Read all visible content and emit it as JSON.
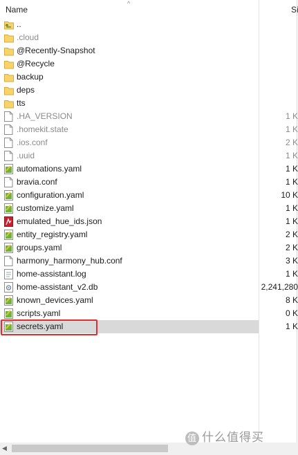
{
  "header": {
    "name_label": "Name",
    "size_label": "Si",
    "sort_indicator": "^"
  },
  "files": [
    {
      "name": "..",
      "icon": "folder-up-icon",
      "size": "",
      "muted": false
    },
    {
      "name": ".cloud",
      "icon": "folder-icon",
      "size": "",
      "muted": true
    },
    {
      "name": "@Recently-Snapshot",
      "icon": "folder-icon",
      "size": "",
      "muted": false
    },
    {
      "name": "@Recycle",
      "icon": "folder-icon",
      "size": "",
      "muted": false
    },
    {
      "name": "backup",
      "icon": "folder-icon",
      "size": "",
      "muted": false
    },
    {
      "name": "deps",
      "icon": "folder-icon",
      "size": "",
      "muted": false
    },
    {
      "name": "tts",
      "icon": "folder-icon",
      "size": "",
      "muted": false
    },
    {
      "name": ".HA_VERSION",
      "icon": "file-icon",
      "size": "1 K",
      "muted": true
    },
    {
      "name": ".homekit.state",
      "icon": "file-icon",
      "size": "1 K",
      "muted": true
    },
    {
      "name": ".ios.conf",
      "icon": "file-icon",
      "size": "2 K",
      "muted": true
    },
    {
      "name": ".uuid",
      "icon": "file-icon",
      "size": "1 K",
      "muted": true
    },
    {
      "name": "automations.yaml",
      "icon": "yaml-file-icon",
      "size": "1 K",
      "muted": false
    },
    {
      "name": "bravia.conf",
      "icon": "file-icon",
      "size": "1 K",
      "muted": false
    },
    {
      "name": "configuration.yaml",
      "icon": "yaml-file-icon",
      "size": "10 K",
      "muted": false
    },
    {
      "name": "customize.yaml",
      "icon": "yaml-file-icon",
      "size": "1 K",
      "muted": false
    },
    {
      "name": "emulated_hue_ids.json",
      "icon": "json-file-icon",
      "size": "1 K",
      "muted": false
    },
    {
      "name": "entity_registry.yaml",
      "icon": "yaml-file-icon",
      "size": "2 K",
      "muted": false
    },
    {
      "name": "groups.yaml",
      "icon": "yaml-file-icon",
      "size": "2 K",
      "muted": false
    },
    {
      "name": "harmony_harmony_hub.conf",
      "icon": "file-icon",
      "size": "3 K",
      "muted": false
    },
    {
      "name": "home-assistant.log",
      "icon": "log-file-icon",
      "size": "1 K",
      "muted": false
    },
    {
      "name": "home-assistant_v2.db",
      "icon": "db-file-icon",
      "size": "2,241,280",
      "muted": false
    },
    {
      "name": "known_devices.yaml",
      "icon": "yaml-file-icon",
      "size": "8 K",
      "muted": false
    },
    {
      "name": "scripts.yaml",
      "icon": "yaml-file-icon",
      "size": "0 K",
      "muted": false
    },
    {
      "name": "secrets.yaml",
      "icon": "yaml-file-icon",
      "size": "1 K",
      "muted": false,
      "selected": true
    }
  ],
  "watermark": {
    "badge": "值",
    "text": "什么值得买"
  }
}
